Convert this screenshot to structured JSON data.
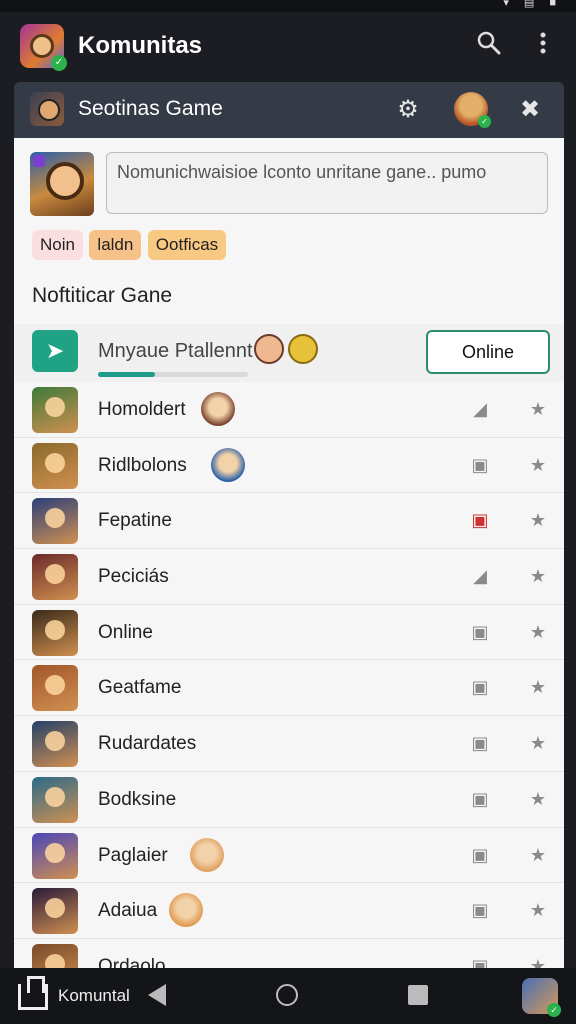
{
  "appbar": {
    "title": "Komunitas",
    "search_icon": "search-icon",
    "more_icon": "more-vertical-icon"
  },
  "panel_header": {
    "title": "Seotinas Game",
    "settings_icon": "gear-icon",
    "close_icon": "close-icon"
  },
  "composer": {
    "placeholder": "Nomunichwaisioe lconto unritane gane.. pumo"
  },
  "tags": [
    "Noin",
    "laldn",
    "Ootficas"
  ],
  "section_title": "Noftiticar Gane",
  "featured": {
    "label": "Mnyaue Ptallennt",
    "progress": 0.38,
    "button": "Online",
    "icon": "arrow-icon"
  },
  "list": [
    {
      "name": "Homoldert",
      "thumb_color": "#3f7a3a",
      "badge_color": "#7a4230",
      "action_icon": "tag-icon",
      "action_red": false
    },
    {
      "name": "Ridlbolons",
      "thumb_color": "#8a6a2a",
      "badge_color": "#2a5fa8",
      "action_icon": "edit-icon",
      "action_red": false
    },
    {
      "name": "Fepatine",
      "thumb_color": "#2b3f7a",
      "badge_color": "",
      "action_icon": "edit-icon",
      "action_red": true
    },
    {
      "name": "Peciciás",
      "thumb_color": "#6a2a2a",
      "badge_color": "",
      "action_icon": "tag-icon",
      "action_red": false
    },
    {
      "name": "Online",
      "thumb_color": "#3a2a1a",
      "badge_color": "",
      "action_icon": "edit-icon",
      "action_red": false
    },
    {
      "name": "Geatfame",
      "thumb_color": "#a2562a",
      "badge_color": "",
      "action_icon": "edit-icon",
      "action_red": false
    },
    {
      "name": "Rudardates",
      "thumb_color": "#24406a",
      "badge_color": "",
      "action_icon": "edit-icon",
      "action_red": false
    },
    {
      "name": "Bodksine",
      "thumb_color": "#2b6a8a",
      "badge_color": "",
      "action_icon": "edit-icon",
      "action_red": false
    },
    {
      "name": "Paglaier",
      "thumb_color": "#4a46b8",
      "badge_color": "#e0a060",
      "action_icon": "edit-icon",
      "action_red": false
    },
    {
      "name": "Adaiua",
      "thumb_color": "#2a1a3a",
      "badge_color": "#e09a50",
      "action_icon": "edit-icon",
      "action_red": false
    },
    {
      "name": "Ordaolo",
      "thumb_color": "#7a4a2a",
      "badge_color": "",
      "action_icon": "edit-icon",
      "action_red": false
    }
  ],
  "navbar": {
    "label": "Komuntal"
  }
}
